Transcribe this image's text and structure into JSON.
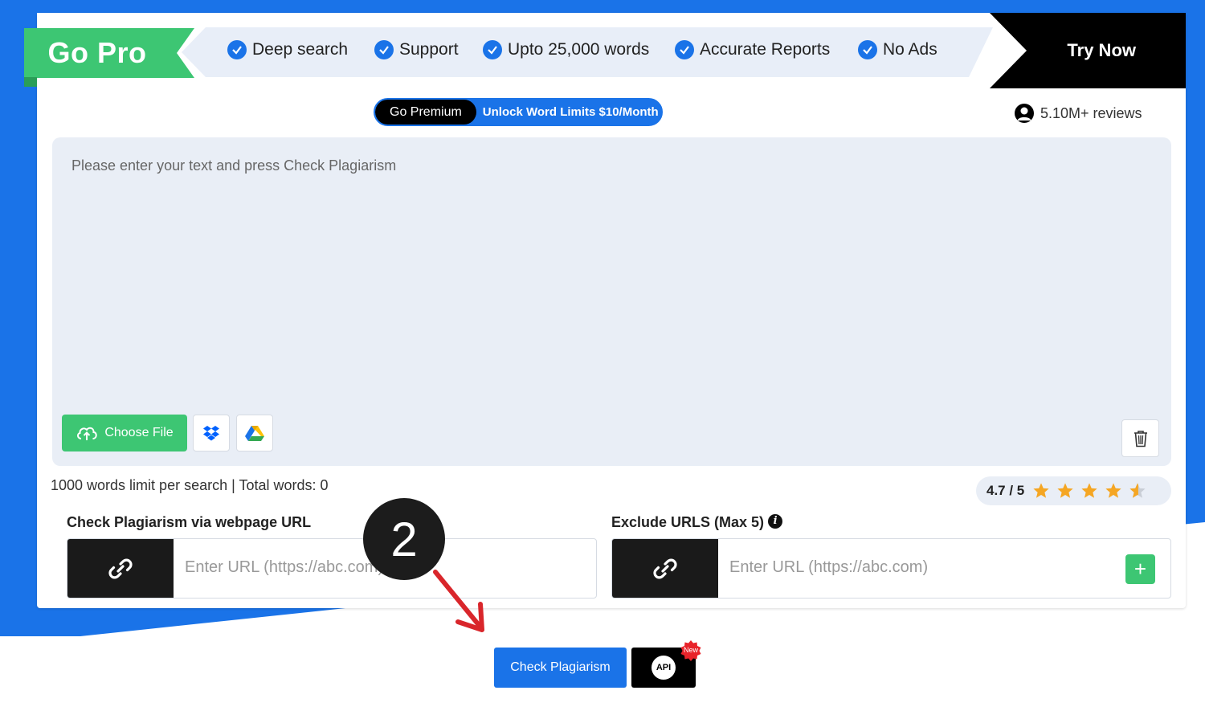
{
  "header": {
    "gopro_label": "Go Pro",
    "features": [
      "Deep search",
      "Support",
      "Upto 25,000 words",
      "Accurate Reports",
      "No Ads"
    ],
    "try_now_label": "Try Now"
  },
  "premium": {
    "go_premium_label": "Go Premium",
    "unlock_label": "Unlock Word Limits $10/Month"
  },
  "reviews": {
    "count_label": "5.10M+ reviews"
  },
  "editor": {
    "placeholder": "Please enter your text and press Check Plagiarism",
    "choose_file_label": "Choose File"
  },
  "limit_text": "1000 words limit per search | Total words: 0",
  "rating": {
    "label": "4.7 / 5",
    "value": 4.7,
    "max": 5
  },
  "url_check": {
    "label": "Check Plagiarism via webpage URL",
    "placeholder": "Enter URL (https://abc.com)"
  },
  "exclude_urls": {
    "label": "Exclude URLS (Max 5)",
    "placeholder": "Enter URL (https://abc.com)",
    "add_label": "+"
  },
  "step_badge": "2",
  "actions": {
    "check_label": "Check Plagiarism",
    "api_label": "API",
    "new_label": "New"
  },
  "colors": {
    "brand_blue": "#1a73e8",
    "green": "#3dc673",
    "star": "#f5a623",
    "arrow_red": "#d9262b"
  }
}
